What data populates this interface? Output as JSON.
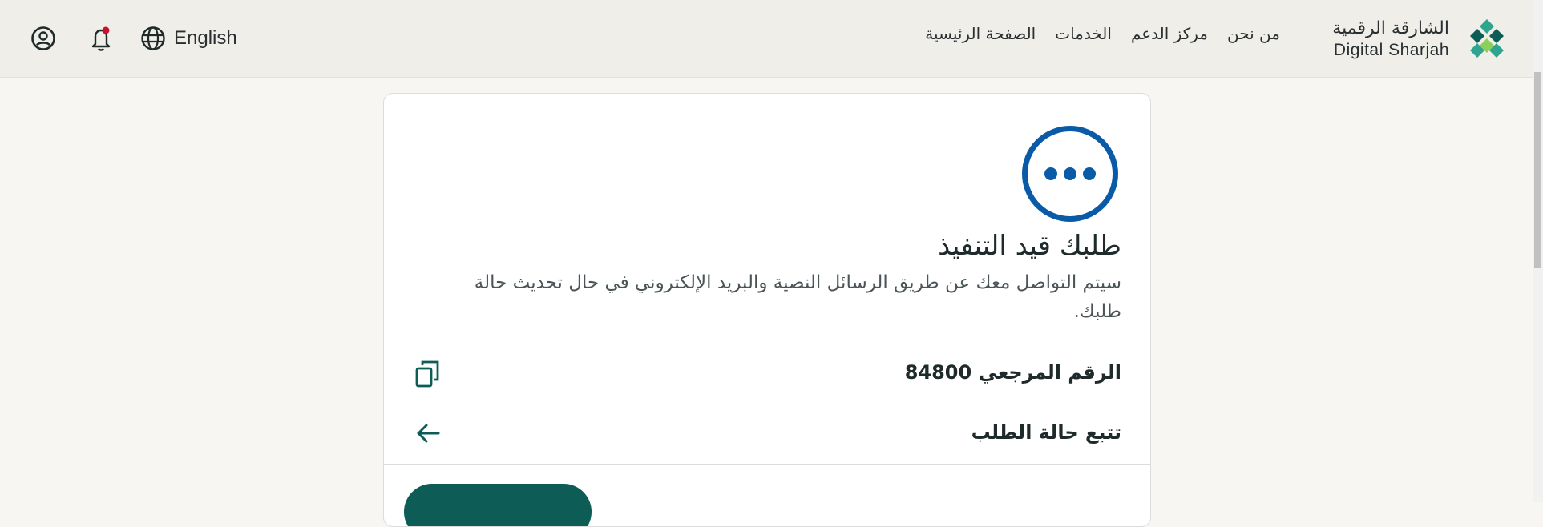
{
  "header": {
    "language_label": "English",
    "nav": [
      "الصفحة الرئيسية",
      "الخدمات",
      "مركز الدعم",
      "من نحن"
    ],
    "logo_ar": "الشارقة الرقمية",
    "logo_en": "Digital Sharjah",
    "icons": {
      "account": "user-circle-icon",
      "notifications": "bell-icon",
      "language": "globe-icon"
    },
    "colors": {
      "brand_green": "#0d5c55",
      "brand_teal": "#2fa58f",
      "notification_dot": "#c8102e"
    }
  },
  "status": {
    "title": "طلبك قيد التنفيذ",
    "description": "سيتم التواصل معك عن طريق الرسائل النصية والبريد الإلكتروني في حال تحديث حالة طلبك.",
    "icon": "pending-dots-icon",
    "color": "#0a5ba7"
  },
  "rows": {
    "reference_label": "الرقم المرجعي 84800",
    "reference_icon": "copy-icon",
    "track_label": "تتبع حالة الطلب",
    "track_icon": "arrow-left-icon"
  }
}
